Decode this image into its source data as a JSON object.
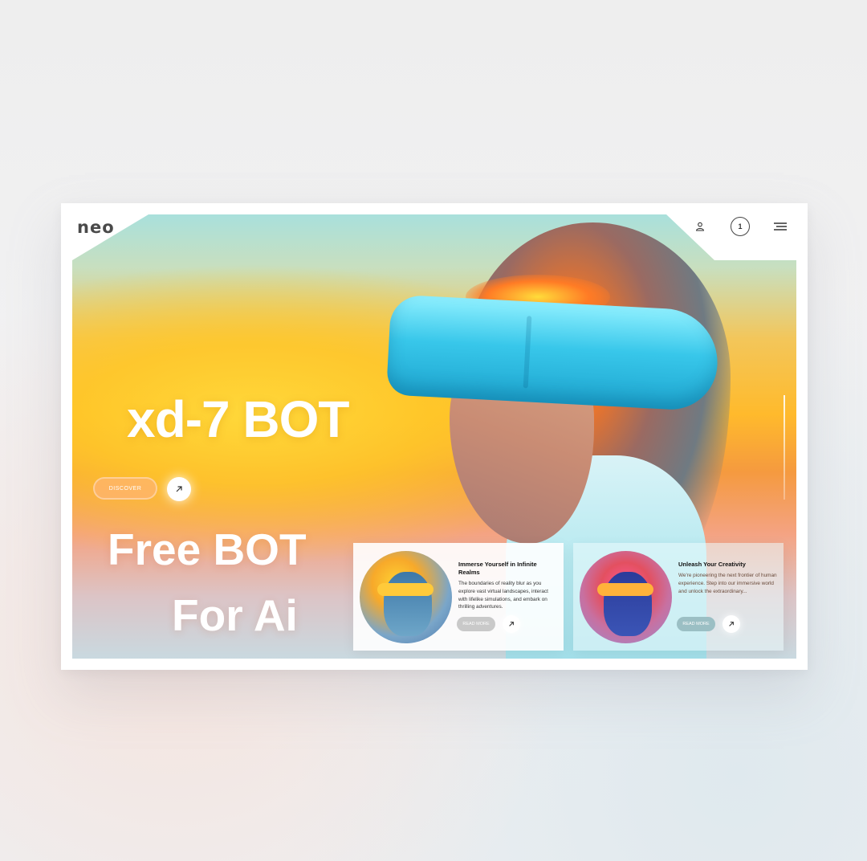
{
  "header": {
    "logo": "neo",
    "cart_count": "1"
  },
  "hero": {
    "title": "xd-7 BOT",
    "tagline_line1": "Free BOT",
    "tagline_line2": "For Ai",
    "discover_label": "DISCOVER"
  },
  "cards": [
    {
      "title": "Immerse Yourself in Infinite Realms",
      "body": "The boundaries of reality blur as you explore vast virtual landscapes, interact with lifelike simulations, and embark on thrilling adventures.",
      "button": "READ MORE"
    },
    {
      "title": "Unleash Your Creativity",
      "body": "We're pioneering the next frontier of human experience. Step into our immersive world and unlock the extraordinary...",
      "button": "READ MORE"
    }
  ],
  "icons": {
    "user": "user-icon",
    "cart": "cart-badge",
    "menu": "menu-icon",
    "arrow": "arrow-up-right-icon"
  },
  "colors": {
    "accent": "#ffb22a",
    "headset": "#38c7ea",
    "logo_text": "#4a4a4a"
  }
}
